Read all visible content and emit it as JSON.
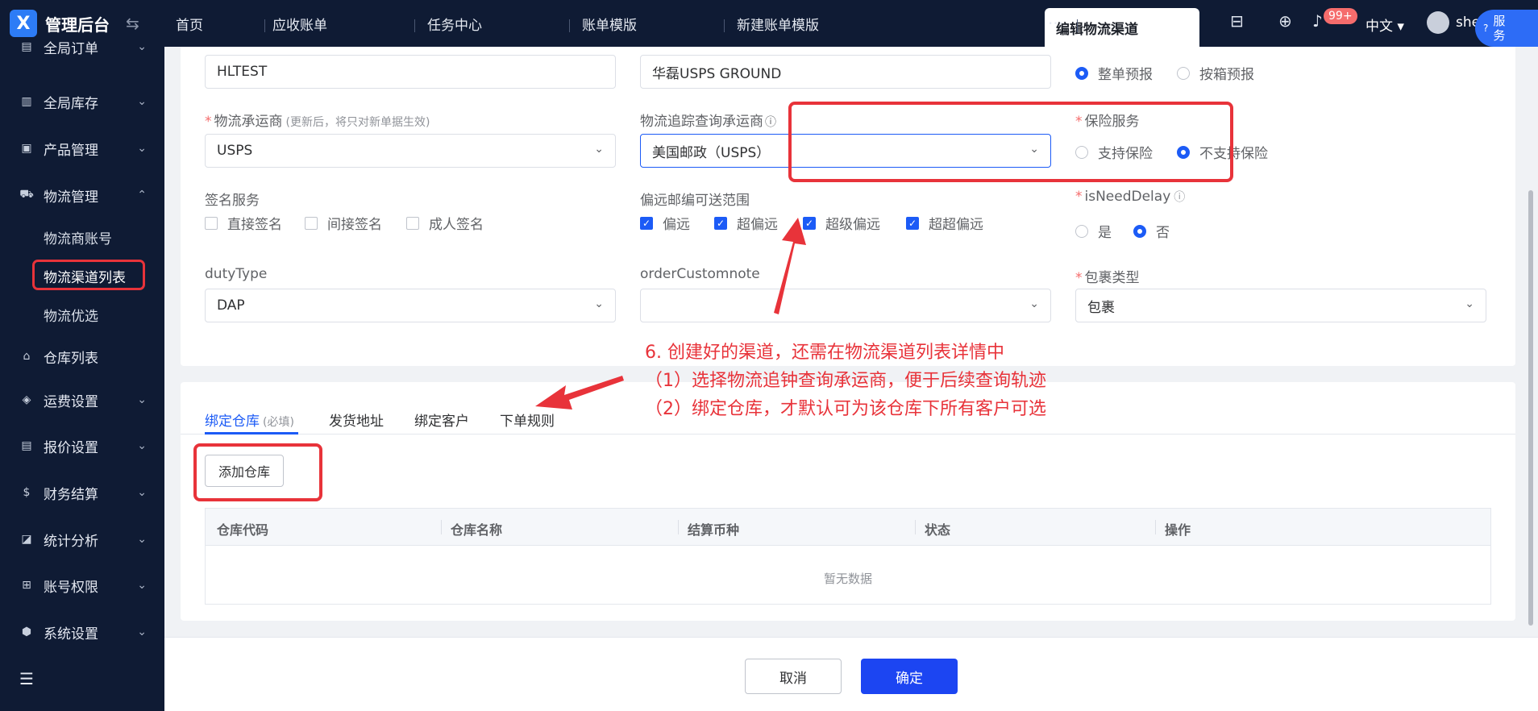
{
  "app": {
    "name": "管理后台",
    "logo": "X"
  },
  "sidebar": {
    "items": [
      {
        "label": "全局订单",
        "icon": "order-icon",
        "glyph": "▤"
      },
      {
        "label": "全局库存",
        "icon": "inventory-icon",
        "glyph": "▥"
      },
      {
        "label": "产品管理",
        "icon": "product-icon",
        "glyph": "▣"
      },
      {
        "label": "物流管理",
        "icon": "truck-icon",
        "glyph": "⛟"
      },
      {
        "label": "仓库列表",
        "icon": "warehouse-icon",
        "glyph": "⌂"
      },
      {
        "label": "运费设置",
        "icon": "freight-icon",
        "glyph": "◈"
      },
      {
        "label": "报价设置",
        "icon": "quote-icon",
        "glyph": "▤"
      },
      {
        "label": "财务结算",
        "icon": "finance-icon",
        "glyph": "$"
      },
      {
        "label": "统计分析",
        "icon": "chart-icon",
        "glyph": "◪"
      },
      {
        "label": "账号权限",
        "icon": "org-icon",
        "glyph": "⊞"
      },
      {
        "label": "系统设置",
        "icon": "settings-icon",
        "glyph": "⬢"
      }
    ],
    "sub_items": [
      "物流商账号",
      "物流渠道列表",
      "物流优选"
    ],
    "collapse_glyph": "☰"
  },
  "header": {
    "tabs": [
      "首页",
      "应收账单",
      "任务中心",
      "账单模版",
      "新建账单模版"
    ],
    "active_tab": "编辑物流渠道",
    "more": "···",
    "notification_badge": "99+",
    "language": "中文 ▾",
    "user": "she",
    "service_label": "服务",
    "service_icon": "?"
  },
  "form": {
    "channel_code_value": "HLTEST",
    "channel_name_value": "华磊USPS GROUND",
    "forecast_options": [
      "整单预报",
      "按箱预报"
    ],
    "carrier_label": "物流承运商",
    "carrier_hint": "(更新后，将只对新单据生效)",
    "carrier_value": "USPS",
    "tracking_label": "物流追踪查询承运商",
    "tracking_value": "美国邮政（USPS）",
    "insurance_label": "保险服务",
    "insurance_options": [
      "支持保险",
      "不支持保险"
    ],
    "signature_label": "签名服务",
    "signature_options": [
      "直接签名",
      "间接签名",
      "成人签名"
    ],
    "remote_label": "偏远邮编可送范围",
    "remote_options": [
      "偏远",
      "超偏远",
      "超级偏远",
      "超超偏远"
    ],
    "delay_label": "isNeedDelay",
    "delay_options": [
      "是",
      "否"
    ],
    "duty_label": "dutyType",
    "duty_value": "DAP",
    "note_label": "orderCustomnote",
    "note_value": "",
    "package_label": "包裹类型",
    "package_value": "包裹"
  },
  "bottom_tabs": {
    "tabs": [
      "绑定仓库",
      "发货地址",
      "绑定客户",
      "下单规则"
    ],
    "required_tag": "(必填)"
  },
  "warehouse": {
    "add_button": "添加仓库",
    "columns": [
      "仓库代码",
      "仓库名称",
      "结算币种",
      "状态",
      "操作"
    ],
    "empty_text": "暂无数据"
  },
  "annotation": {
    "lines": [
      "6. 创建好的渠道，还需在物流渠道列表详情中",
      "（1）选择物流追钟查询承运商，便于后续查询轨迹",
      "（2）绑定仓库，才默认可为该仓库下所有客户可选"
    ],
    "color": "#e8333a"
  },
  "footer": {
    "cancel": "取消",
    "confirm": "确定"
  },
  "colors": {
    "primary": "#1c45f2",
    "sidebar": "#0f1b34",
    "highlight": "#e8333a"
  }
}
